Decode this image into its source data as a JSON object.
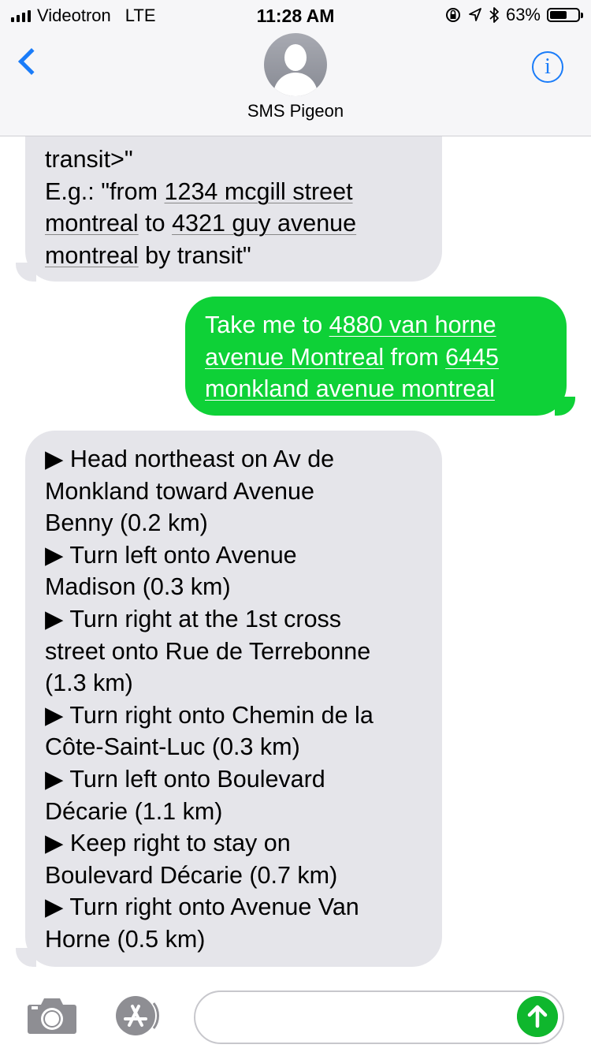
{
  "status_bar": {
    "carrier": "Videotron",
    "network": "LTE",
    "time": "11:28 AM",
    "battery": "63%",
    "battery_level": 0.63,
    "icons": [
      "orientation-lock-icon",
      "location-arrow-icon",
      "bluetooth-icon"
    ]
  },
  "header": {
    "contact_name": "SMS Pigeon",
    "back_icon": "chevron-left-icon",
    "info_icon": "info-icon",
    "info_glyph": "i"
  },
  "messages": [
    {
      "direction": "received",
      "lines": [
        [
          {
            "t": "transit>\""
          }
        ],
        [
          {
            "t": "E.g.: \"from "
          },
          {
            "t": "1234 mcgill street",
            "link": true
          }
        ],
        [
          {
            "t": "montreal",
            "link": true
          },
          {
            "t": " to "
          },
          {
            "t": "4321 guy avenue",
            "link": true
          }
        ],
        [
          {
            "t": "montreal",
            "link": true
          },
          {
            "t": " by transit\""
          }
        ]
      ]
    },
    {
      "direction": "sent",
      "lines": [
        [
          {
            "t": "Take me to "
          },
          {
            "t": "4880 van horne",
            "link": true
          }
        ],
        [
          {
            "t": "avenue Montreal",
            "link": true
          },
          {
            "t": " from "
          },
          {
            "t": "6445",
            "link": true
          }
        ],
        [
          {
            "t": "monkland avenue montreal",
            "link": true
          }
        ]
      ]
    },
    {
      "direction": "received",
      "lines": [
        [
          {
            "t": "▶ Head northeast on Av de"
          }
        ],
        [
          {
            "t": "Monkland toward Avenue"
          }
        ],
        [
          {
            "t": "Benny (0.2 km)"
          }
        ],
        [
          {
            "t": "▶ Turn left onto Avenue"
          }
        ],
        [
          {
            "t": "Madison (0.3 km)"
          }
        ],
        [
          {
            "t": "▶ Turn right at the 1st cross"
          }
        ],
        [
          {
            "t": "street onto Rue de Terrebonne"
          }
        ],
        [
          {
            "t": "(1.3 km)"
          }
        ],
        [
          {
            "t": "▶ Turn right onto Chemin de la"
          }
        ],
        [
          {
            "t": "Côte-Saint-Luc (0.3 km)"
          }
        ],
        [
          {
            "t": "▶ Turn left onto Boulevard"
          }
        ],
        [
          {
            "t": "Décarie (1.1 km)"
          }
        ],
        [
          {
            "t": "▶ Keep right to stay on"
          }
        ],
        [
          {
            "t": "Boulevard Décarie (0.7 km)"
          }
        ],
        [
          {
            "t": "▶ Turn right onto Avenue Van"
          }
        ],
        [
          {
            "t": "Horne (0.5 km)"
          }
        ]
      ]
    }
  ],
  "input_bar": {
    "camera_icon": "camera-icon",
    "apps_icon": "app-store-icon",
    "send_icon": "send-arrow-icon",
    "message_placeholder": ""
  },
  "colors": {
    "sent_bubble": "#0ed137",
    "received_bubble": "#e5e5ea",
    "ios_blue": "#1a7cf9",
    "send_button": "#0fb72d"
  }
}
